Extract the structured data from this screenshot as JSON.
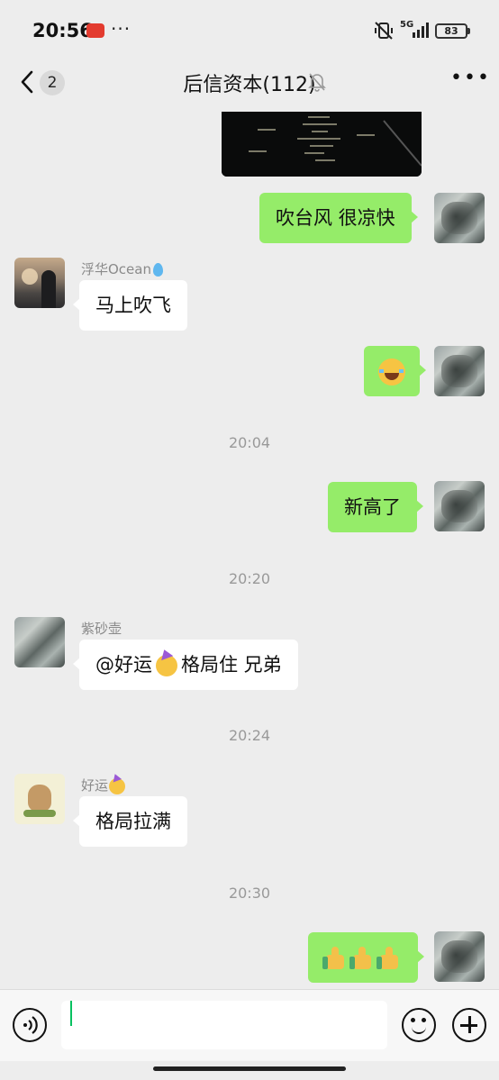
{
  "status_bar": {
    "time": "20:56",
    "network": "5G",
    "battery": "83"
  },
  "header": {
    "unread_count": "2",
    "title": "后信资本(112)"
  },
  "messages": [
    {
      "type": "image",
      "direction": "out"
    },
    {
      "direction": "out",
      "text": "吹台风 很凉快"
    },
    {
      "direction": "in",
      "sender": "浮华Ocean",
      "text": "马上吹飞"
    },
    {
      "direction": "out",
      "emoji": "laughing-tears"
    },
    {
      "time_divider": "20:04"
    },
    {
      "direction": "out",
      "text": "新高了"
    },
    {
      "time_divider": "20:20"
    },
    {
      "direction": "in",
      "sender": "紫砂壶",
      "text_prefix": "@好运",
      "text_suffix": "格局住 兄弟"
    },
    {
      "time_divider": "20:24"
    },
    {
      "direction": "in",
      "sender": "好运",
      "text": "格局拉满"
    },
    {
      "time_divider": "20:30"
    },
    {
      "direction": "out",
      "emoji": "thumbs-up x3"
    }
  ],
  "input": {
    "value": ""
  },
  "colors": {
    "outgoing_bubble": "#95ec69",
    "incoming_bubble": "#ffffff",
    "background": "#ededed",
    "cursor": "#07c160"
  }
}
